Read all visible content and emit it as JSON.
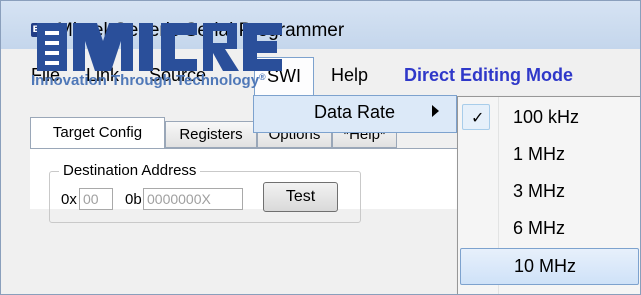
{
  "window": {
    "title": "Micrel Generic Serial Programmer",
    "icon": "app-icon",
    "icon_text": "EM"
  },
  "menubar": {
    "items": [
      {
        "label": "File"
      },
      {
        "label": "Link"
      },
      {
        "label": "Source"
      },
      {
        "label": "SWI"
      },
      {
        "label": "Help"
      }
    ],
    "mode_label": "Direct Editing Mode",
    "mode_color": "#2f38c9"
  },
  "swi_menu": {
    "items": [
      {
        "label": "Data Rate",
        "has_submenu": true
      }
    ]
  },
  "data_rate_submenu": {
    "items": [
      {
        "label": "100 kHz",
        "checked": true
      },
      {
        "label": "1 MHz"
      },
      {
        "label": "3 MHz"
      },
      {
        "label": "6 MHz"
      },
      {
        "label": "10 MHz",
        "highlighted": true
      }
    ]
  },
  "logo": {
    "name": "MICREL",
    "tagline": "Innovation Through Technology",
    "tagline_mark": "®",
    "brand_color": "#2a4f9a"
  },
  "tabs": [
    {
      "label": "Target Config",
      "active": true
    },
    {
      "label": "Registers"
    },
    {
      "label": "Options"
    },
    {
      "label": "*Help*"
    }
  ],
  "destination": {
    "group_title": "Destination Address",
    "hex_prefix": "0x",
    "hex_placeholder": "00",
    "bin_prefix": "0b",
    "bin_placeholder": "0000000X",
    "test_label": "Test"
  }
}
